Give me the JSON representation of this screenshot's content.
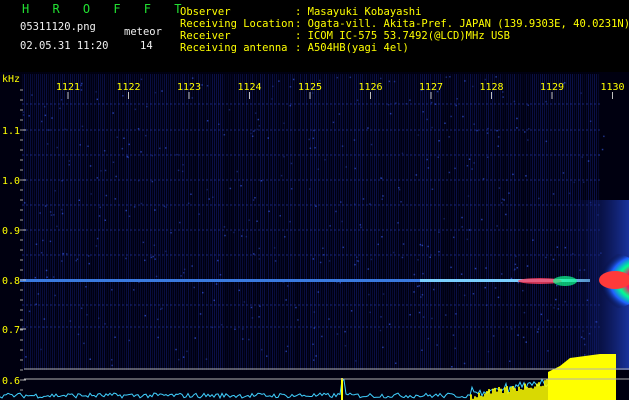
{
  "header": {
    "app_title": "H R O F F T",
    "filename": "05311120.png",
    "counter_label": "meteor",
    "datetime": "02.05.31 11:20",
    "meteor_count": "14",
    "info": [
      {
        "label": "Observer",
        "value": ": Masayuki Kobayashi"
      },
      {
        "label": "Receiving Location",
        "value": ": Ogata-vill. Akita-Pref. JAPAN (139.9303E, 40.0231N)"
      },
      {
        "label": "Receiver",
        "value": ": ICOM IC-575 53.7492(@LCD)MHz USB"
      },
      {
        "label": "Receiving antenna",
        "value": ": A504HB(yagi 4el)"
      }
    ]
  },
  "spectrogram": {
    "y_unit": "kHz",
    "y_ticks": [
      "1.1",
      "1.0",
      "0.9",
      "0.8",
      "0.7",
      "0.6"
    ],
    "time_ticks": [
      "1121",
      "1122",
      "1123",
      "1124",
      "1125",
      "1126",
      "1127",
      "1128",
      "1129",
      "1130"
    ],
    "colors": {
      "background": "#000010",
      "noise": "#1a2aa0",
      "carrier": "#55aaff",
      "hot": "#ff2020",
      "warm": "#00ff80",
      "text_yellow": "#ffff00",
      "text_green": "#22e032",
      "signal_cyan": "#40d0ff"
    }
  }
}
